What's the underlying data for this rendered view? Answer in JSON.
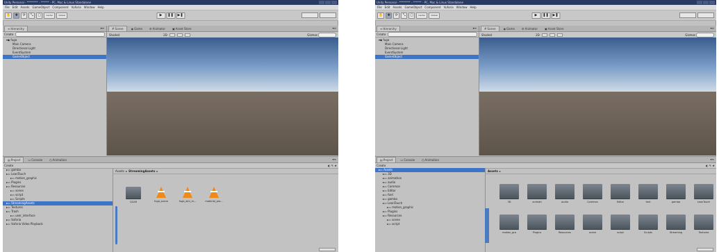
{
  "left": {
    "title": "Unity Personal - ******** - ****** - PC, Mac & Linux Standalone",
    "menu": [
      "File",
      "Edit",
      "Assets",
      "GameObject",
      "Component",
      "Vuforia",
      "Window",
      "Help"
    ],
    "toolbar": {
      "pivot": "Center",
      "space": "Global"
    },
    "hierarchy": {
      "tab": "Hierarchy",
      "create": "Create",
      "scene": "fuga",
      "items": [
        "Main Camera",
        "Directional Light",
        "EventSystem",
        "GameObject"
      ],
      "selected_index": 3
    },
    "scene_tabs": [
      "Scene",
      "Game",
      "Animator",
      "Asset Store"
    ],
    "scene_toolbar": {
      "shading": "Shaded",
      "mode": "2D",
      "gizmos": "Gizmos"
    },
    "project": {
      "tabs": [
        "Project",
        "Console",
        "Animation"
      ],
      "create": "Create",
      "tree": [
        "gamba",
        "LeanTouch",
        "motion_graphic",
        "Plugins",
        "Resources",
        "scene",
        "script",
        "Scripts",
        "StreamingAssets",
        "Textures",
        "Trash",
        "user_interface",
        "Vuforia",
        "Vuforia Video Playback"
      ],
      "tree_indent": [
        0,
        0,
        1,
        0,
        0,
        1,
        1,
        1,
        0,
        0,
        0,
        1,
        0,
        0
      ],
      "selected_tree_index": 8,
      "breadcrumb_root": "Assets",
      "breadcrumb_current": "StreamingAssets",
      "assets": [
        {
          "name": "QCAR",
          "kind": "folder"
        },
        {
          "name": "fuga_scene",
          "kind": "cone"
        },
        {
          "name": "fuga_aim_m...",
          "kind": "cone"
        },
        {
          "name": "material_pro...",
          "kind": "cone"
        }
      ]
    }
  },
  "right": {
    "title": "Unity Personal - ******** - ****** - PC, Mac & Linux Standalone",
    "menu": [
      "File",
      "Edit",
      "Assets",
      "GameObject",
      "Component",
      "Vuforia",
      "Window",
      "Help"
    ],
    "toolbar": {
      "pivot": "Center",
      "space": "Global"
    },
    "hierarchy": {
      "tab": "Hierarchy",
      "create": "Create",
      "scene": "fuga",
      "items": [
        "Main Camera",
        "Directional Light",
        "EventSystem",
        "GameObject"
      ],
      "selected_index": 3
    },
    "scene_tabs": [
      "Scene",
      "Game",
      "Animator",
      "Asset Store"
    ],
    "scene_toolbar": {
      "shading": "Shaded",
      "mode": "2D",
      "gizmos": "Gizmos"
    },
    "project": {
      "tabs": [
        "Project",
        "Console",
        "Animation"
      ],
      "create": "Create",
      "tree": [
        "Assets",
        "3D",
        "animation",
        "audio",
        "Common",
        "Editor",
        "font",
        "gamba",
        "LeanTouch",
        "motion_graphic",
        "Plugins",
        "Resources",
        "scene",
        "script"
      ],
      "tree_indent": [
        0,
        1,
        1,
        1,
        1,
        1,
        1,
        1,
        1,
        2,
        1,
        1,
        2,
        2
      ],
      "selected_tree_index": 0,
      "breadcrumb_root": "Assets",
      "assets": [
        {
          "name": "3D"
        },
        {
          "name": "animati"
        },
        {
          "name": "audio"
        },
        {
          "name": "Common"
        },
        {
          "name": "Editor"
        },
        {
          "name": "font"
        },
        {
          "name": "gamba"
        },
        {
          "name": "LeanTouch"
        },
        {
          "name": "motion_gra"
        },
        {
          "name": "Plugins"
        },
        {
          "name": "Resources"
        },
        {
          "name": "scene"
        },
        {
          "name": "script"
        },
        {
          "name": "Scripts"
        },
        {
          "name": "Streaming"
        },
        {
          "name": "Textures"
        }
      ]
    }
  },
  "icons": {
    "play": "play-icon",
    "pause": "pause-icon",
    "step": "step-icon",
    "hand": "hand-tool-icon",
    "move": "move-tool-icon",
    "rotate": "rotate-tool-icon",
    "scale": "scale-tool-icon",
    "rect": "rect-tool-icon"
  },
  "colors": {
    "selection": "#3d74c8",
    "panel": "#c2c2c2",
    "folder": "#5d656d",
    "cone": "#ef8a18"
  }
}
